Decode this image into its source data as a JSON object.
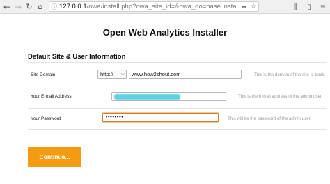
{
  "browser": {
    "url_host": "127.0.0.1",
    "url_path": "/owa/install.php?owa_site_id=&owa_do=base.insta",
    "icons": {
      "back": "back-arrow-icon",
      "forward": "forward-arrow-icon",
      "reload": "reload-icon",
      "home": "home-icon",
      "info": "info-icon",
      "page_actions": "page-actions-dots-icon",
      "bookmark": "bookmark-star-icon",
      "library": "library-icon",
      "sidebar": "sidebar-icon",
      "menu": "hamburger-menu-icon"
    }
  },
  "page": {
    "title": "Open Web Analytics Installer",
    "section_title": "Default Site & User Information",
    "site_domain": {
      "label": "Site Domain",
      "protocol_selected": "http://",
      "value": "www.how2shout.com",
      "help": "This is the domain of the site to track."
    },
    "email": {
      "label": "Your E-mail Address",
      "value": "",
      "help": "This is the e-mail address of the admin user."
    },
    "password": {
      "label": "Your Password",
      "value": "••••••••",
      "help": "This will be the password of the admin user."
    },
    "continue_label": "Continue..."
  },
  "colors": {
    "accent_button": "#f39c12",
    "focus_border": "#d87a2e",
    "redaction": "#5fd0e6"
  }
}
